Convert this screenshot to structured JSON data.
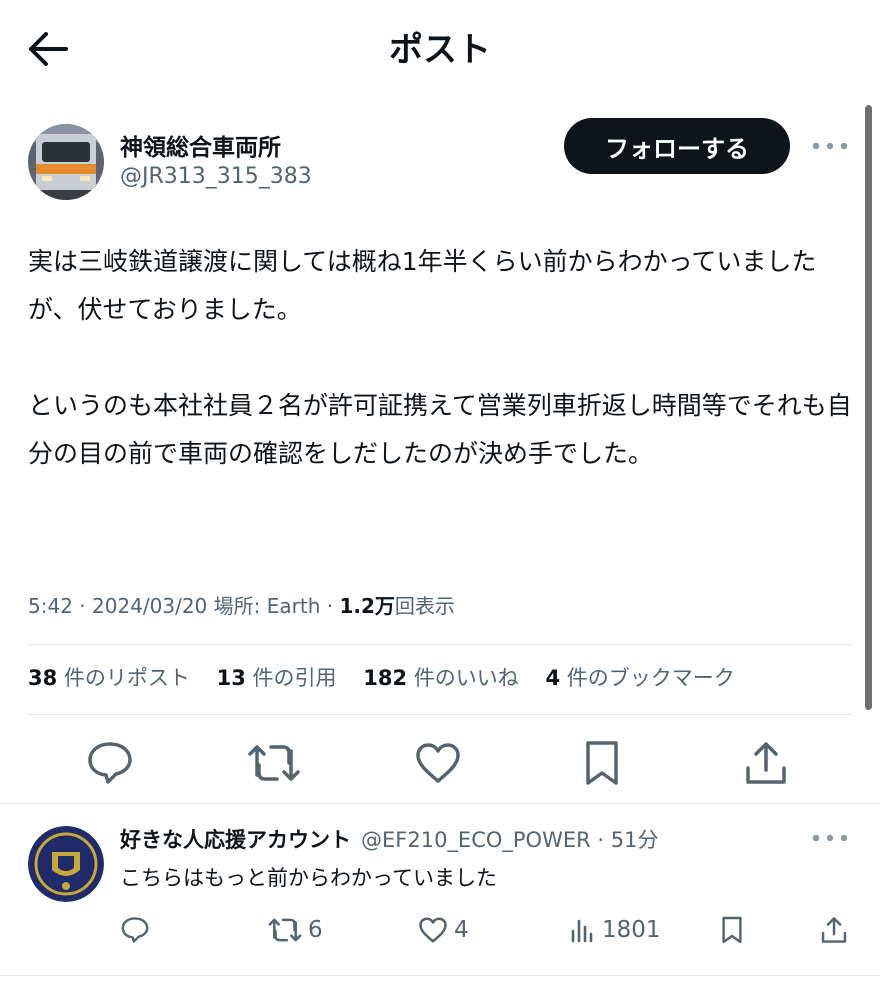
{
  "header": {
    "title": "ポスト",
    "back_icon": "arrow-left-icon"
  },
  "post": {
    "author_name": "神領総合車両所",
    "author_handle": "@JR313_315_383",
    "follow_label": "フォローする",
    "paragraphs": [
      "実は三岐鉄道譲渡に関しては概ね1年半くらい前からわかっていましたが、伏せておりました。",
      "というのも本社社員２名が許可証携えて営業列車折返し時間等でそれも自分の目の前で車両の確認をしだしたのが決め手でした。"
    ],
    "time": "5:42",
    "date": "2024/03/20",
    "location": "場所: Earth",
    "views_count": "1.2万",
    "views_label": "回表示",
    "stats": [
      {
        "count": "38",
        "label": "件のリポスト"
      },
      {
        "count": "13",
        "label": "件の引用"
      },
      {
        "count": "182",
        "label": "件のいいね"
      },
      {
        "count": "4",
        "label": "件のブックマーク"
      }
    ],
    "actions": [
      "reply-icon",
      "repost-icon",
      "like-icon",
      "bookmark-icon",
      "share-icon"
    ]
  },
  "reply": {
    "name": "好きな人応援アカウント",
    "handle": "@EF210_ECO_POWER",
    "time": "51分",
    "text": "こちらはもっと前からわかっていました",
    "reposts": "6",
    "likes": "4",
    "views": "1801"
  },
  "colors": {
    "text": "#0f1419",
    "secondary": "#536471",
    "border": "#e6e9ec",
    "follow_bg": "#0f1419"
  }
}
